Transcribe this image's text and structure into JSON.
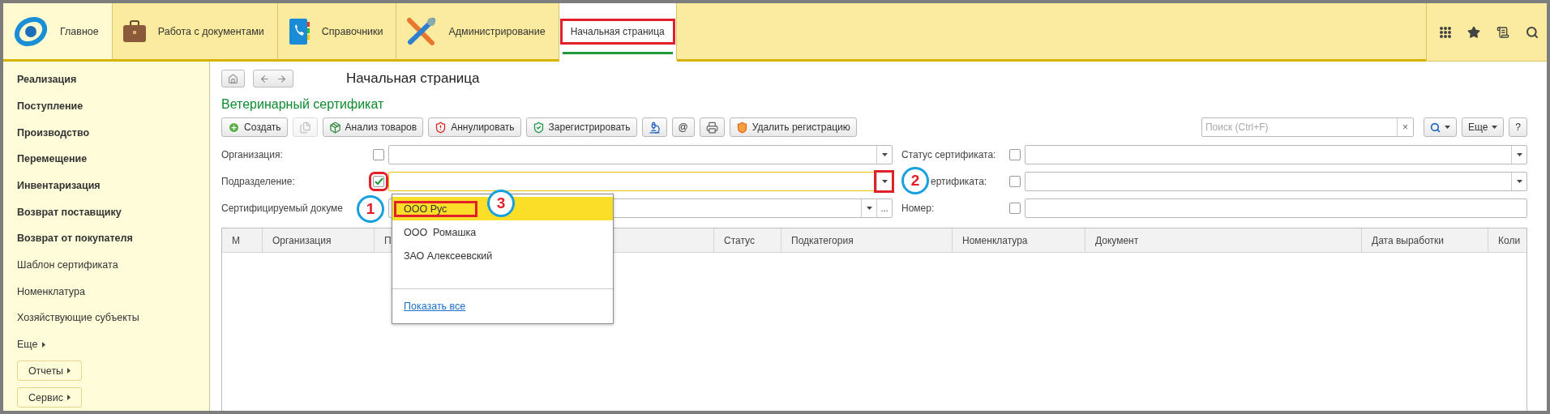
{
  "top_sections": [
    {
      "label": "Главное",
      "selected": true
    },
    {
      "label": "Работа с документами",
      "selected": false
    },
    {
      "label": "Справочники",
      "selected": false
    },
    {
      "label": "Администрирование",
      "selected": false
    }
  ],
  "open_tabs": [
    {
      "label": "Начальная страница",
      "selected": true,
      "annotated": true
    }
  ],
  "sidebar": {
    "items": [
      {
        "label": "Реализация",
        "kind": "section"
      },
      {
        "label": "Поступление",
        "kind": "section"
      },
      {
        "label": "Производство",
        "kind": "section"
      },
      {
        "label": "Перемещение",
        "kind": "section"
      },
      {
        "label": "Инвентаризация",
        "kind": "section"
      },
      {
        "label": "Возврат поставщику",
        "kind": "section"
      },
      {
        "label": "Возврат от покупателя",
        "kind": "section"
      },
      {
        "label": "Шаблон сертификата",
        "kind": "command"
      },
      {
        "label": "Номенклатура",
        "kind": "command"
      },
      {
        "label": "Хозяйствующие субъекты",
        "kind": "command"
      }
    ],
    "more": "Еще",
    "buttons": [
      {
        "label": "Отчеты"
      },
      {
        "label": "Сервис"
      }
    ]
  },
  "page_title": "Начальная страница",
  "form": {
    "title": "Ветеринарный сертификат",
    "toolbar": [
      {
        "kind": "button",
        "label": "Создать",
        "disabled": false
      },
      {
        "kind": "icon",
        "disabled": true
      },
      {
        "kind": "button",
        "label": "Анализ товаров",
        "disabled": false
      },
      {
        "kind": "button",
        "label": "Аннулировать",
        "disabled": false
      },
      {
        "kind": "button",
        "label": "Зарегистрировать",
        "disabled": false
      },
      {
        "kind": "icon",
        "disabled": false
      },
      {
        "kind": "button",
        "label": "@",
        "disabled": false
      },
      {
        "kind": "icon",
        "disabled": false
      },
      {
        "kind": "button",
        "label": "Удалить регистрацию",
        "disabled": false
      }
    ],
    "search": {
      "placeholder": "Поиск (Ctrl+F)",
      "clear": "×"
    },
    "more": "Еще",
    "help": "?",
    "filters": [
      {
        "left": {
          "label": "Организация:",
          "checked": false,
          "kind": "select",
          "focused": false
        },
        "right": {
          "label": "Статус сертификата:",
          "checked": false,
          "kind": "select",
          "focused": false
        }
      },
      {
        "left": {
          "label": "Подразделение:",
          "checked": true,
          "kind": "select",
          "focused": true,
          "checkbox_annotated": true,
          "button_annotated": true
        },
        "right": {
          "label": "ертификата:",
          "checked": false,
          "kind": "select",
          "focused": false
        }
      },
      {
        "left": {
          "label": "Сертифицируемый докуме",
          "kind": "choice",
          "focused": false,
          "choice_button": "..."
        },
        "right": {
          "label": "Номер:",
          "checked": false,
          "kind": "text",
          "focused": false
        }
      }
    ],
    "table": {
      "columns": [
        "М",
        "Организация",
        "П",
        "Статус",
        "Подкатегория",
        "Номенклатура",
        "Документ",
        "Дата выработки",
        "Коли"
      ]
    },
    "dropdown": {
      "items": [
        {
          "label": "ООО Рус",
          "selected": true,
          "annotated": true
        },
        {
          "label": "ООО  Ромашка",
          "selected": false,
          "annotated": false
        },
        {
          "label": "ЗАО Алексеевский",
          "selected": false,
          "annotated": false
        }
      ],
      "show_all": "Показать все"
    }
  },
  "annotation_marks": [
    "1",
    "2",
    "3"
  ]
}
